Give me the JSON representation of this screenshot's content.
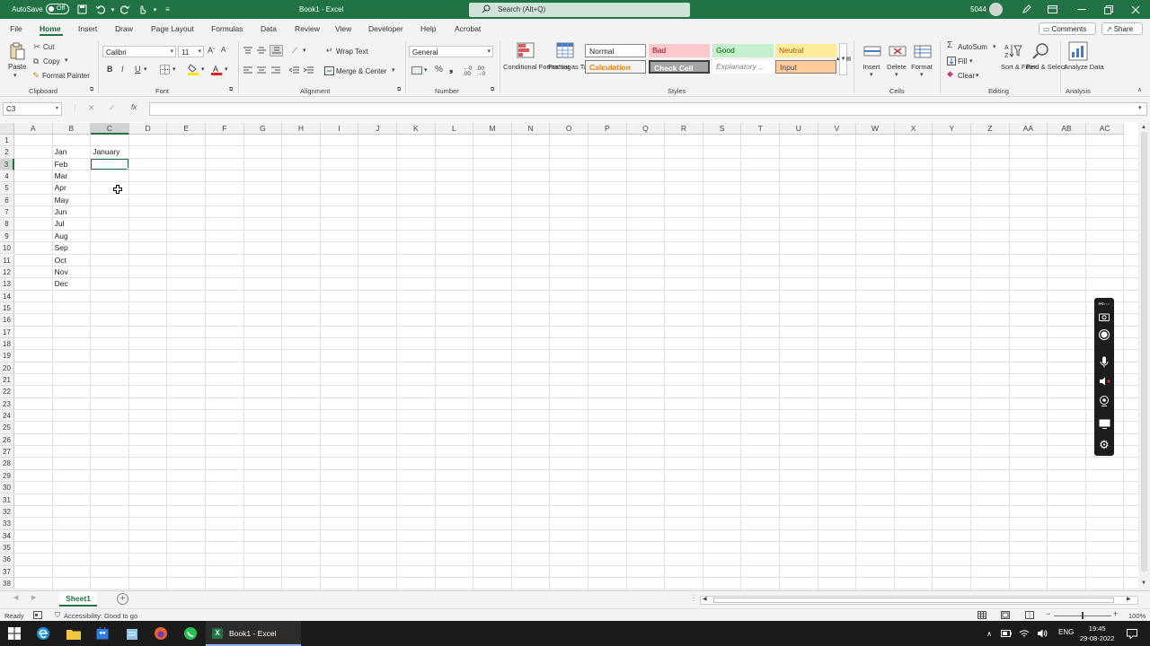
{
  "titlebar": {
    "autosave_label": "AutoSave",
    "autosave_state": "Off",
    "title": "Book1 - Excel",
    "search_placeholder": "Search (Alt+Q)",
    "user_id": "5044"
  },
  "menu": {
    "tabs": [
      "File",
      "Home",
      "Insert",
      "Draw",
      "Page Layout",
      "Formulas",
      "Data",
      "Review",
      "View",
      "Developer",
      "Help",
      "Acrobat"
    ],
    "comments": "Comments",
    "share": "Share"
  },
  "ribbon": {
    "clipboard": {
      "paste": "Paste",
      "cut": "Cut",
      "copy": "Copy",
      "format_painter": "Format Painter",
      "label": "Clipboard"
    },
    "font": {
      "name": "Calibri",
      "size": "11",
      "bold": "B",
      "italic": "I",
      "underline": "U",
      "label": "Font"
    },
    "alignment": {
      "wrap_text": "Wrap Text",
      "merge_center": "Merge & Center",
      "label": "Alignment"
    },
    "number": {
      "format": "General",
      "label": "Number"
    },
    "styles": {
      "conditional_formatting": "Conditional Formatting",
      "format_as_table": "Format as Table",
      "normal": "Normal",
      "bad": "Bad",
      "good": "Good",
      "neutral": "Neutral",
      "calculation": "Calculation",
      "check_cell": "Check Cell",
      "explanatory": "Explanatory ...",
      "input": "Input",
      "label": "Styles"
    },
    "cells": {
      "insert": "Insert",
      "delete": "Delete",
      "format": "Format",
      "label": "Cells"
    },
    "editing": {
      "autosum": "AutoSum",
      "fill": "Fill",
      "clear": "Clear",
      "sort_filter": "Sort & Filter",
      "find_select": "Find & Select",
      "label": "Editing"
    },
    "analysis": {
      "analyze_data": "Analyze Data",
      "label": "Analysis"
    }
  },
  "formula_bar": {
    "name_box": "C3",
    "formula": "",
    "fx": "fx"
  },
  "sheet": {
    "columns": [
      "A",
      "B",
      "C",
      "D",
      "E",
      "F",
      "G",
      "H",
      "I",
      "J",
      "K",
      "L",
      "M",
      "N",
      "O",
      "P",
      "Q",
      "R",
      "S",
      "T",
      "U",
      "V",
      "W",
      "X",
      "Y",
      "Z",
      "AA",
      "AB",
      "AC"
    ],
    "row_count": 38,
    "selected_cell": "C3",
    "cells": [
      {
        "ref": "B2",
        "value": "Jan"
      },
      {
        "ref": "C2",
        "value": "January"
      },
      {
        "ref": "B3",
        "value": "Feb"
      },
      {
        "ref": "B4",
        "value": "Mar"
      },
      {
        "ref": "B5",
        "value": "Apr"
      },
      {
        "ref": "B6",
        "value": "May"
      },
      {
        "ref": "B7",
        "value": "Jun"
      },
      {
        "ref": "B8",
        "value": "Jul"
      },
      {
        "ref": "B9",
        "value": "Aug"
      },
      {
        "ref": "B10",
        "value": "Sep"
      },
      {
        "ref": "B11",
        "value": "Oct"
      },
      {
        "ref": "B12",
        "value": "Nov"
      },
      {
        "ref": "B13",
        "value": "Dec"
      }
    ]
  },
  "sheet_tabs": [
    "Sheet1"
  ],
  "status": {
    "ready": "Ready",
    "accessibility": "Accessibility: Good to go",
    "zoom": "100%"
  },
  "taskbar": {
    "excel_label": "Book1 - Excel",
    "language": "ENG",
    "time": "19:45",
    "date": "29-08-2022"
  },
  "colors": {
    "excel_green": "#217346",
    "bad_bg": "#ffc7ce",
    "good_bg": "#c6efce",
    "neutral_bg": "#ffeb9c",
    "input_bg": "#ffcc99"
  }
}
